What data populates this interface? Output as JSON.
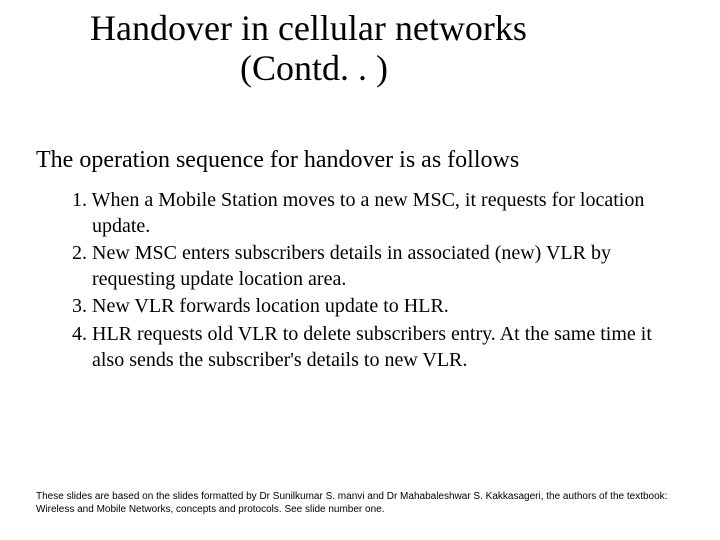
{
  "title": {
    "line1": "Handover in cellular networks",
    "line2": "(Contd. . )"
  },
  "intro": "The operation sequence for handover is as follows",
  "steps": [
    "1. When a Mobile Station moves to a new MSC, it requests for location update.",
    "2. New MSC enters subscribers details in associated (new) VLR by requesting update location area.",
    "3. New VLR forwards location update to HLR.",
    "4. HLR requests old VLR to delete subscribers entry. At the same time it also sends the subscriber's details to new VLR."
  ],
  "footer": "These slides are based on the slides formatted by Dr Sunilkumar S. manvi and Dr Mahabaleshwar S. Kakkasageri, the authors of the textbook: Wireless and Mobile Networks, concepts and protocols. See slide number one."
}
